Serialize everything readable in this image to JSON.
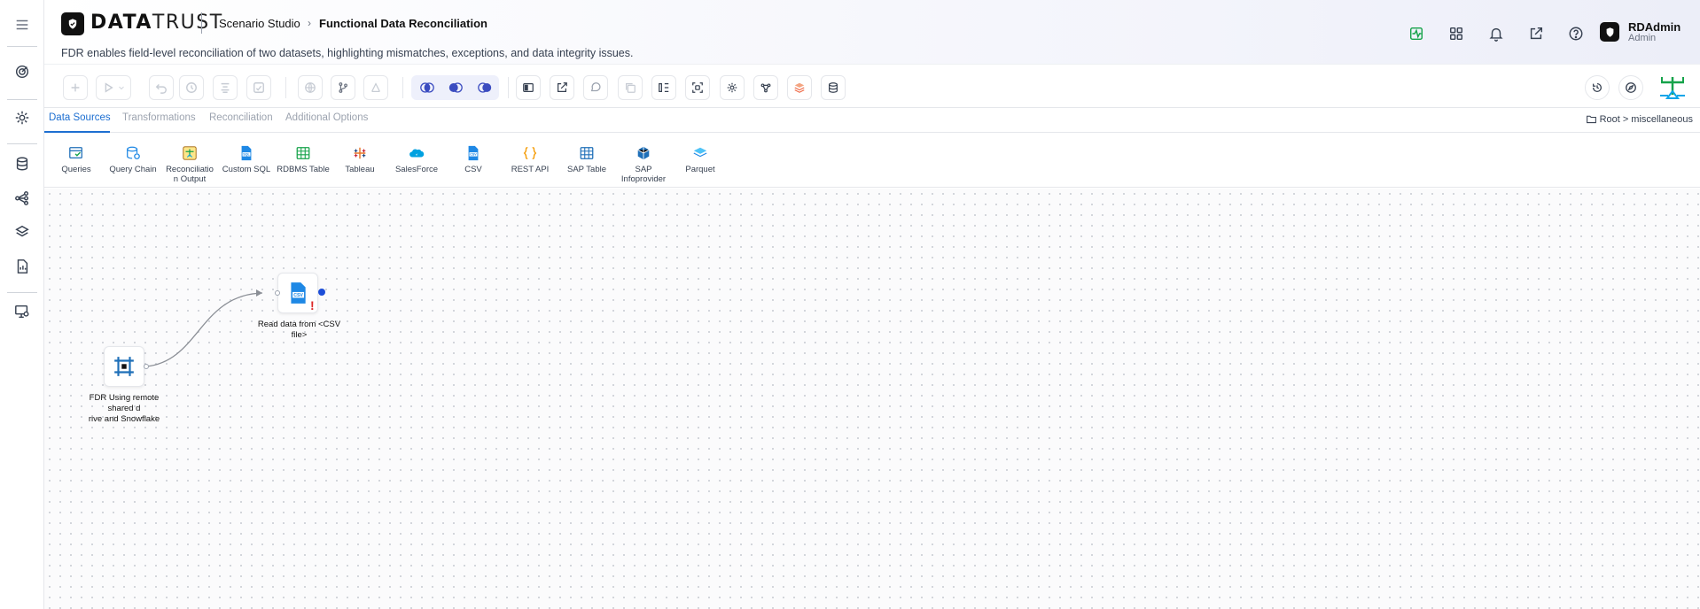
{
  "app": {
    "brand_bold": "DATA",
    "brand_light": "TRUST",
    "breadcrumb": [
      "Scenario Studio",
      "Functional Data Reconciliation"
    ],
    "description": "FDR enables field-level reconciliation of two datasets, highlighting mismatches, exceptions, and data integrity issues."
  },
  "user": {
    "name": "RDAdmin",
    "role": "Admin"
  },
  "tabs": [
    {
      "label": "Data Sources",
      "active": true
    },
    {
      "label": "Transformations",
      "active": false
    },
    {
      "label": "Reconciliation",
      "active": false
    },
    {
      "label": "Additional Options",
      "active": false
    }
  ],
  "folder_path": {
    "root": "Root",
    "sep": ">",
    "folder": "miscellaneous"
  },
  "palette": [
    {
      "label": "Queries",
      "icon": "queries-icon"
    },
    {
      "label": "Query Chain",
      "icon": "query-chain-icon"
    },
    {
      "label": "Reconciliatio n Output",
      "icon": "reconciliation-output-icon"
    },
    {
      "label": "Custom SQL",
      "icon": "sql-file-icon"
    },
    {
      "label": "RDBMS Table",
      "icon": "table-icon"
    },
    {
      "label": "Tableau",
      "icon": "tableau-icon"
    },
    {
      "label": "SalesForce",
      "icon": "salesforce-cloud-icon"
    },
    {
      "label": "CSV",
      "icon": "csv-file-icon"
    },
    {
      "label": "REST API",
      "icon": "braces-icon"
    },
    {
      "label": "SAP Table",
      "icon": "sap-table-icon"
    },
    {
      "label": "SAP Infoprovider",
      "icon": "cube-icon"
    },
    {
      "label": "Parquet",
      "icon": "parquet-icon"
    }
  ],
  "nodes": {
    "csv": {
      "label": "Read data from <CSV file>",
      "icon_text": "CSV",
      "warning": "!"
    },
    "fdr": {
      "label_line1": "FDR Using remote shared d",
      "label_line2": "rive and Snowflake"
    }
  },
  "colors": {
    "accent": "#1d6fd1",
    "success": "#16a34a",
    "warning": "#dc2626",
    "csv_blue": "#1e88e5"
  }
}
